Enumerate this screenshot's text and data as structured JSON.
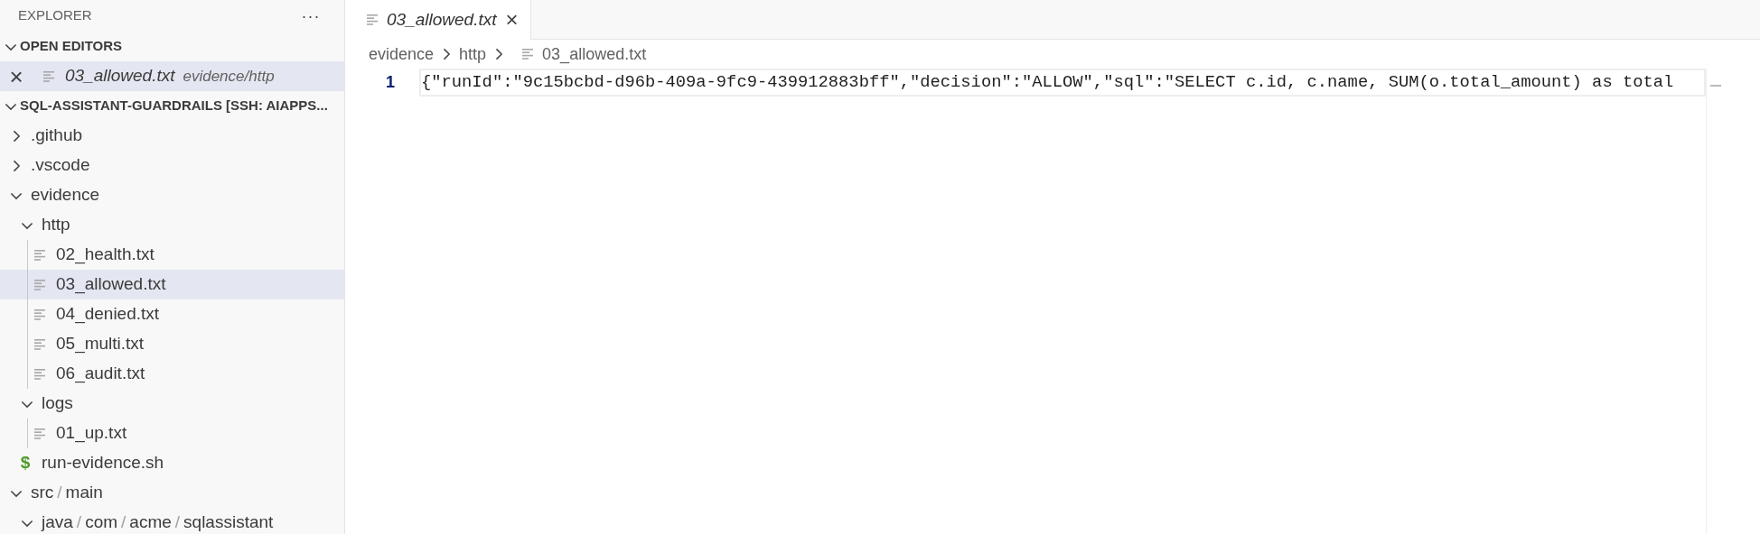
{
  "sidebar": {
    "title": "EXPLORER",
    "more": "···",
    "open_editors": {
      "title": "OPEN EDITORS",
      "expanded": true,
      "items": [
        {
          "name": "03_allowed.txt",
          "description": "evidence/http",
          "close": "×",
          "preview": true,
          "selected": true
        }
      ]
    },
    "workspace": {
      "title": "SQL-ASSISTANT-GUARDRAILS [SSH: AIAPPS...",
      "expanded": true,
      "separator": "/",
      "tree": [
        {
          "kind": "folder",
          "segments": [
            ".github"
          ],
          "expanded": false,
          "selected": false
        },
        {
          "kind": "folder",
          "segments": [
            ".vscode"
          ],
          "expanded": false,
          "selected": false
        },
        {
          "kind": "folder",
          "segments": [
            "evidence"
          ],
          "expanded": true,
          "selected": false,
          "children": [
            {
              "kind": "folder",
              "segments": [
                "http"
              ],
              "expanded": true,
              "selected": false,
              "children": [
                {
                  "kind": "file",
                  "label": "02_health.txt",
                  "selected": false
                },
                {
                  "kind": "file",
                  "label": "03_allowed.txt",
                  "selected": true
                },
                {
                  "kind": "file",
                  "label": "04_denied.txt",
                  "selected": false
                },
                {
                  "kind": "file",
                  "label": "05_multi.txt",
                  "selected": false
                },
                {
                  "kind": "file",
                  "label": "06_audit.txt",
                  "selected": false
                }
              ]
            },
            {
              "kind": "folder",
              "segments": [
                "logs"
              ],
              "expanded": true,
              "selected": false,
              "children": [
                {
                  "kind": "file",
                  "label": "01_up.txt",
                  "selected": false
                }
              ]
            },
            {
              "kind": "script",
              "label": "run-evidence.sh",
              "icon": "$",
              "selected": false
            }
          ]
        },
        {
          "kind": "folder",
          "segments": [
            "src",
            "main"
          ],
          "expanded": true,
          "selected": false,
          "children": [
            {
              "kind": "folder",
              "segments": [
                "java",
                "com",
                "acme",
                "sqlassistant"
              ],
              "expanded": true,
              "selected": false
            }
          ]
        }
      ]
    }
  },
  "editor": {
    "tabs": [
      {
        "label": "03_allowed.txt",
        "close": "×",
        "preview": true,
        "selected": true
      }
    ],
    "breadcrumb": [
      {
        "kind": "folder",
        "label": "evidence"
      },
      {
        "kind": "folder",
        "label": "http"
      },
      {
        "kind": "file",
        "label": "03_allowed.txt"
      }
    ],
    "lines": [
      {
        "number": "1",
        "text": "{\"runId\":\"9c15bcbd-d96b-409a-9fc9-439912883bff\",\"decision\":\"ALLOW\",\"sql\":\"SELECT c.id, c.name, SUM(o.total_amount) as total",
        "current": true
      }
    ]
  }
}
